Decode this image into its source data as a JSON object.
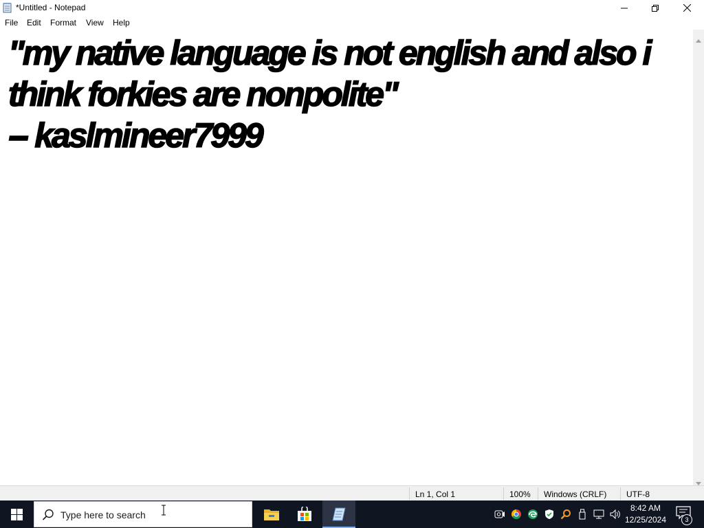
{
  "window": {
    "title": "*Untitled - Notepad",
    "icon": "notepad-icon"
  },
  "menu": {
    "items": [
      {
        "label": "File"
      },
      {
        "label": "Edit"
      },
      {
        "label": "Format"
      },
      {
        "label": "View"
      },
      {
        "label": "Help"
      }
    ]
  },
  "editor": {
    "content": "\"my native language is not english and also i think forkies are nonpolite\"\n-- kaslmineer7999"
  },
  "status": {
    "position": "Ln 1, Col 1",
    "zoom": "100%",
    "line_ending": "Windows (CRLF)",
    "encoding": "UTF-8"
  },
  "taskbar": {
    "search_placeholder": "Type here to search",
    "pinned": [
      {
        "name": "file-explorer-icon"
      },
      {
        "name": "microsoft-store-icon"
      },
      {
        "name": "notepad-icon",
        "active": true
      }
    ],
    "tray_icons": [
      "meet-now-icon",
      "chrome-icon",
      "edge-icon",
      "windows-security-icon",
      "search-tool-icon",
      "usb-icon",
      "network-icon",
      "volume-icon"
    ],
    "clock": {
      "time": "8:42 AM",
      "date": "12/25/2024"
    },
    "notifications": {
      "count": "3"
    }
  },
  "colors": {
    "taskbar_bg": "#101522",
    "active_app_bg": "#2b3345",
    "active_indicator": "#7fb2f0"
  }
}
